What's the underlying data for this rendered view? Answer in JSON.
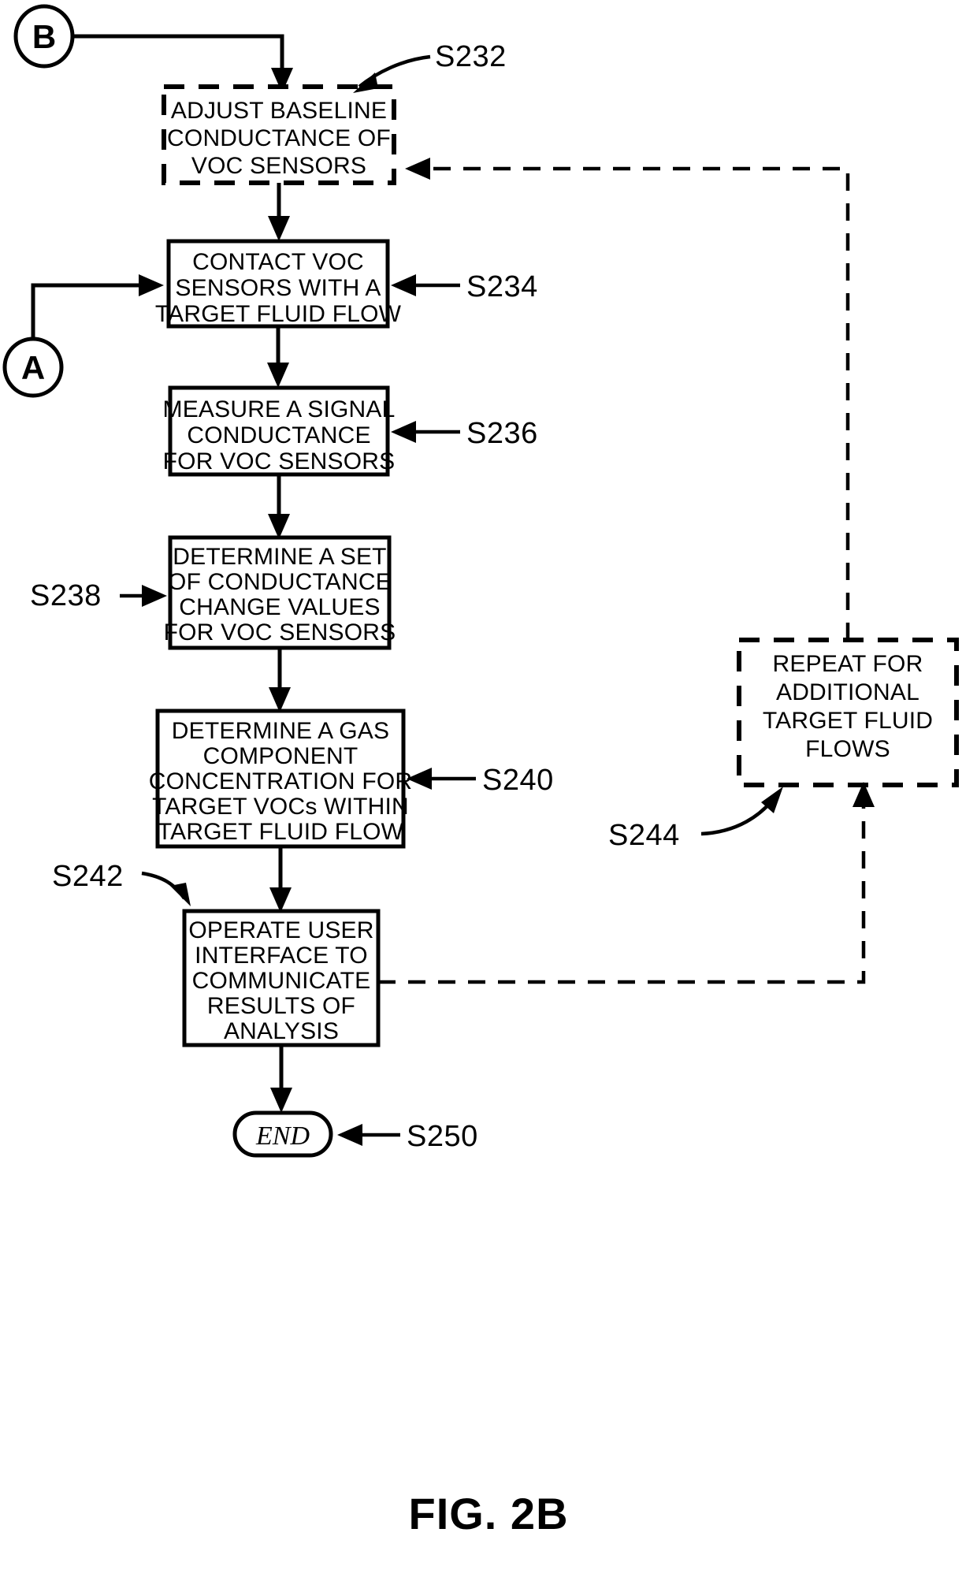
{
  "figure": {
    "caption": "FIG. 2B",
    "connectors": [
      {
        "id": "conn-b",
        "label": "B"
      },
      {
        "id": "conn-a",
        "label": "A"
      }
    ],
    "terminal": {
      "label": "END",
      "ref": "S250"
    },
    "steps": [
      {
        "id": "step-s232",
        "ref": "S232",
        "style": "dashed",
        "lines": [
          "ADJUST BASELINE",
          "CONDUCTANCE OF",
          "VOC SENSORS"
        ]
      },
      {
        "id": "step-s234",
        "ref": "S234",
        "style": "solid",
        "lines": [
          "CONTACT VOC",
          "SENSORS WITH A",
          "TARGET FLUID FLOW"
        ]
      },
      {
        "id": "step-s236",
        "ref": "S236",
        "style": "solid",
        "lines": [
          "MEASURE A SIGNAL",
          "CONDUCTANCE",
          "FOR VOC SENSORS"
        ]
      },
      {
        "id": "step-s238",
        "ref": "S238",
        "style": "solid",
        "lines": [
          "DETERMINE A SET",
          "OF CONDUCTANCE",
          "CHANGE VALUES",
          "FOR VOC SENSORS"
        ]
      },
      {
        "id": "step-s240",
        "ref": "S240",
        "style": "solid",
        "lines": [
          "DETERMINE A GAS",
          "COMPONENT",
          "CONCENTRATION FOR",
          "TARGET VOCs WITHIN",
          "TARGET FLUID FLOW"
        ]
      },
      {
        "id": "step-s242",
        "ref": "S242",
        "style": "solid",
        "lines": [
          "OPERATE USER",
          "INTERFACE TO",
          "COMMUNICATE",
          "RESULTS OF",
          "ANALYSIS"
        ]
      },
      {
        "id": "step-s244",
        "ref": "S244",
        "style": "dashed",
        "lines": [
          "REPEAT FOR",
          "ADDITIONAL",
          "TARGET FLUID",
          "FLOWS"
        ]
      }
    ],
    "colors": {
      "ink": "#000000",
      "paper": "#ffffff"
    }
  }
}
